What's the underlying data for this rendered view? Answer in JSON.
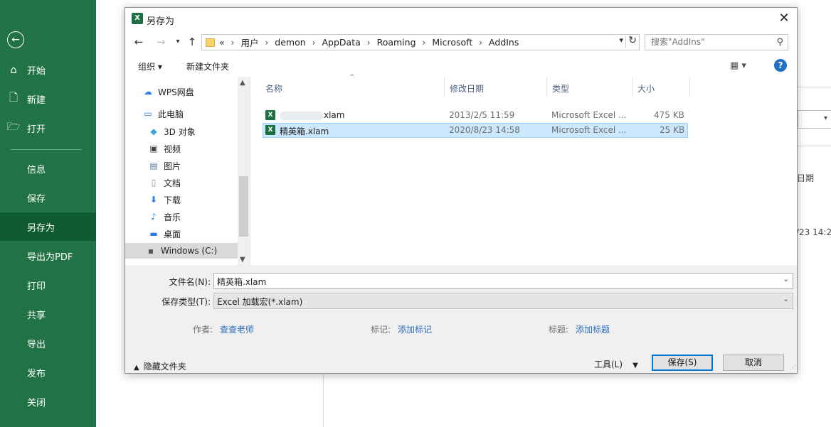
{
  "backstage": {
    "back_icon": "back-arrow-icon",
    "items": [
      {
        "label": "开始",
        "icon": "home-icon"
      },
      {
        "label": "新建",
        "icon": "new-file-icon"
      },
      {
        "label": "打开",
        "icon": "open-folder-icon"
      },
      {
        "label": "信息"
      },
      {
        "label": "保存"
      },
      {
        "label": "另存为",
        "active": true
      },
      {
        "label": "导出为PDF"
      },
      {
        "label": "打印"
      },
      {
        "label": "共享"
      },
      {
        "label": "导出"
      },
      {
        "label": "发布"
      },
      {
        "label": "关闭"
      }
    ],
    "colors": {
      "sidebar": "#217346",
      "active": "#0e5c2f"
    }
  },
  "background": {
    "date_label": "日期",
    "date_value": "/23 14:2"
  },
  "dialog": {
    "title": "另存为",
    "close_icon": "close-icon",
    "breadcrumb": {
      "overflow": "«",
      "parts": [
        "用户",
        "demon",
        "AppData",
        "Roaming",
        "Microsoft",
        "AddIns"
      ]
    },
    "search_placeholder": "搜索\"AddIns\"",
    "toolbar": {
      "organize": "组织 ▾",
      "new_folder": "新建文件夹",
      "view_icon": "▦ ▾",
      "help": "?"
    },
    "nav_pane": [
      {
        "label": "WPS网盘",
        "icon": "cloud-icon"
      },
      {
        "label": "此电脑",
        "icon": "computer-icon"
      },
      {
        "label": "3D 对象",
        "icon": "3d-objects-icon"
      },
      {
        "label": "视频",
        "icon": "video-icon"
      },
      {
        "label": "图片",
        "icon": "pictures-icon"
      },
      {
        "label": "文档",
        "icon": "documents-icon"
      },
      {
        "label": "下载",
        "icon": "download-icon"
      },
      {
        "label": "音乐",
        "icon": "music-icon"
      },
      {
        "label": "桌面",
        "icon": "desktop-icon"
      },
      {
        "label": "Windows (C:)",
        "icon": "drive-icon",
        "selected": true
      }
    ],
    "columns": [
      "名称",
      "修改日期",
      "类型",
      "大小"
    ],
    "files": [
      {
        "name": "xlam",
        "name_blurred": true,
        "modified": "2013/2/5 11:59",
        "type": "Microsoft Excel ...",
        "size": "475 KB"
      },
      {
        "name": "精英箱.xlam",
        "modified": "2020/8/23 14:58",
        "type": "Microsoft Excel ...",
        "size": "25 KB",
        "selected": true
      }
    ],
    "form": {
      "filename_label": "文件名(N):",
      "filename_value": "精英箱.xlam",
      "filetype_label": "保存类型(T):",
      "filetype_value": "Excel 加载宏(*.xlam)",
      "author_label": "作者:",
      "author_value": "查查老师",
      "tags_label": "标记:",
      "tags_value": "添加标记",
      "title_label": "标题:",
      "title_value": "添加标题"
    },
    "footer": {
      "hide_folders": "隐藏文件夹",
      "tools": "工具(L)",
      "save": "保存(S)",
      "cancel": "取消"
    }
  }
}
